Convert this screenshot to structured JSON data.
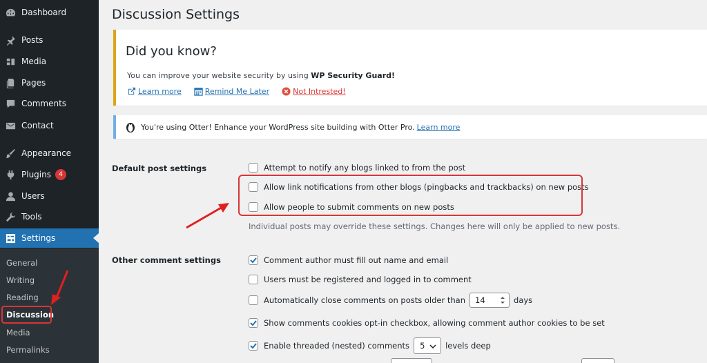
{
  "sidebar": {
    "items": [
      {
        "label": "Dashboard",
        "icon": "dashboard-icon"
      },
      {
        "label": "Posts",
        "icon": "pin-icon"
      },
      {
        "label": "Media",
        "icon": "media-icon"
      },
      {
        "label": "Pages",
        "icon": "pages-icon"
      },
      {
        "label": "Comments",
        "icon": "comments-icon"
      },
      {
        "label": "Contact",
        "icon": "mail-icon"
      },
      {
        "label": "Appearance",
        "icon": "brush-icon"
      },
      {
        "label": "Plugins",
        "icon": "plugin-icon",
        "badge": "4"
      },
      {
        "label": "Users",
        "icon": "users-icon"
      },
      {
        "label": "Tools",
        "icon": "wrench-icon"
      },
      {
        "label": "Settings",
        "icon": "settings-icon"
      }
    ],
    "submenu": [
      "General",
      "Writing",
      "Reading",
      "Discussion",
      "Media",
      "Permalinks"
    ]
  },
  "page": {
    "title": "Discussion Settings"
  },
  "notice": {
    "heading": "Did you know?",
    "text_prefix": "You can improve your website security by using ",
    "text_bold": "WP Security Guard!",
    "learn_more": "Learn more",
    "remind_later": "Remind Me Later",
    "not_interested": "Not Intrested!"
  },
  "otter": {
    "text": "You're using Otter! Enhance your WordPress site building with Otter Pro.",
    "link": "Learn more"
  },
  "default_post": {
    "label": "Default post settings",
    "options": [
      {
        "label": "Attempt to notify any blogs linked to from the post",
        "checked": false
      },
      {
        "label": "Allow link notifications from other blogs (pingbacks and trackbacks) on new posts",
        "checked": false
      },
      {
        "label": "Allow people to submit comments on new posts",
        "checked": false
      }
    ],
    "description": "Individual posts may override these settings. Changes here will only be applied to new posts."
  },
  "other_comment": {
    "label": "Other comment settings",
    "options": [
      {
        "label": "Comment author must fill out name and email",
        "checked": true
      },
      {
        "label": "Users must be registered and logged in to comment",
        "checked": false
      },
      {
        "label": "Automatically close comments on posts older than",
        "checked": false,
        "value": "14",
        "suffix": "days"
      },
      {
        "label": "Show comments cookies opt-in checkbox, allowing comment author cookies to be set",
        "checked": true
      },
      {
        "label": "Enable threaded (nested) comments",
        "checked": true,
        "value": "5",
        "suffix": "levels deep"
      }
    ]
  },
  "colors": {
    "accent": "#2271b1",
    "sidebar": "#1d2327",
    "highlight": "#d63638",
    "notice_warning": "#dba617"
  }
}
